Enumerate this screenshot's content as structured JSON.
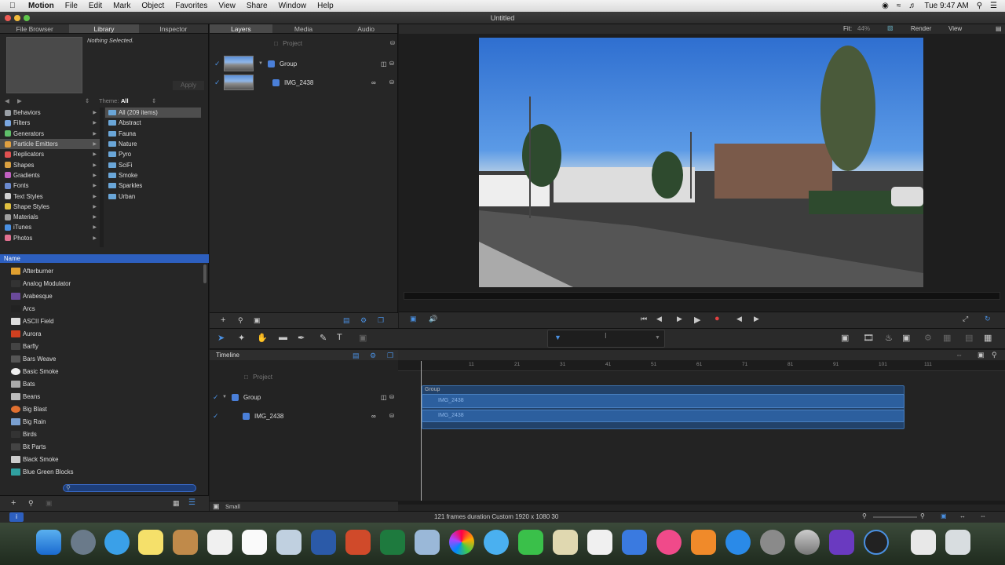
{
  "menubar": {
    "app": "Motion",
    "items": [
      "File",
      "Edit",
      "Mark",
      "Object",
      "Favorites",
      "View",
      "Share",
      "Window",
      "Help"
    ],
    "clock": "Tue 9:47 AM"
  },
  "window": {
    "title": "Untitled"
  },
  "left_tabs": [
    "File Browser",
    "Library",
    "Inspector"
  ],
  "library": {
    "nothing_selected": "Nothing Selected.",
    "apply": "Apply",
    "theme_label": "Theme:",
    "theme_value": "All",
    "categories": [
      {
        "label": "Behaviors",
        "color": "#9aa0a6"
      },
      {
        "label": "Filters",
        "color": "#7aa6e0"
      },
      {
        "label": "Generators",
        "color": "#5fbf6a"
      },
      {
        "label": "Particle Emitters",
        "color": "#e0a040",
        "selected": true
      },
      {
        "label": "Replicators",
        "color": "#e05050"
      },
      {
        "label": "Shapes",
        "color": "#d9a040"
      },
      {
        "label": "Gradients",
        "color": "#c060c0"
      },
      {
        "label": "Fonts",
        "color": "#6a8ad0"
      },
      {
        "label": "Text Styles",
        "color": "#d0d0d0"
      },
      {
        "label": "Shape Styles",
        "color": "#e0c040"
      },
      {
        "label": "Materials",
        "color": "#a0a0a0"
      },
      {
        "label": "iTunes",
        "color": "#4a90e2"
      },
      {
        "label": "Photos",
        "color": "#e07090"
      }
    ],
    "subfolders": [
      "All (209 items)",
      "Abstract",
      "Fauna",
      "Nature",
      "Pyro",
      "SciFi",
      "Smoke",
      "Sparkles",
      "Urban"
    ],
    "name_header": "Name",
    "items": [
      {
        "label": "Afterburner",
        "color": "#e0a030"
      },
      {
        "label": "Analog Modulator",
        "color": "#333"
      },
      {
        "label": "Arabesque",
        "color": "#6a4a9a"
      },
      {
        "label": "Arcs",
        "color": "#222"
      },
      {
        "label": "ASCII Field",
        "color": "#ddd"
      },
      {
        "label": "Aurora",
        "color": "#d04020"
      },
      {
        "label": "Barfly",
        "color": "#444"
      },
      {
        "label": "Bars Weave",
        "color": "#555"
      },
      {
        "label": "Basic Smoke",
        "color": "#eee"
      },
      {
        "label": "Bats",
        "color": "#aaa"
      },
      {
        "label": "Beans",
        "color": "#bbb"
      },
      {
        "label": "Big Blast",
        "color": "#e07030"
      },
      {
        "label": "Big Rain",
        "color": "#7aa0d0"
      },
      {
        "label": "Birds",
        "color": "#333"
      },
      {
        "label": "Bit Parts",
        "color": "#444"
      },
      {
        "label": "Black Smoke",
        "color": "#ccc"
      },
      {
        "label": "Blue Green Blocks",
        "color": "#30a0a0"
      }
    ]
  },
  "layers_tabs": [
    "Layers",
    "Media",
    "Audio"
  ],
  "layers": {
    "project": "Project",
    "group": "Group",
    "clip": "IMG_2438"
  },
  "canvas": {
    "fit_label": "Fit:",
    "fit_value": "44%",
    "render": "Render",
    "view": "View"
  },
  "timeline": {
    "header": "Timeline",
    "project": "Project",
    "group": "Group",
    "clip": "IMG_2438",
    "ticks": [
      "11",
      "21",
      "31",
      "41",
      "51",
      "61",
      "71",
      "81",
      "91",
      "101",
      "111"
    ],
    "track_group": "Group",
    "track_clip": "IMG_2438",
    "zoom_label": "Small"
  },
  "status": {
    "text": "121 frames duration Custom 1920 x 1080 30"
  },
  "colors": {
    "accent": "#2d5fbf",
    "track": "#2c5f9e"
  }
}
